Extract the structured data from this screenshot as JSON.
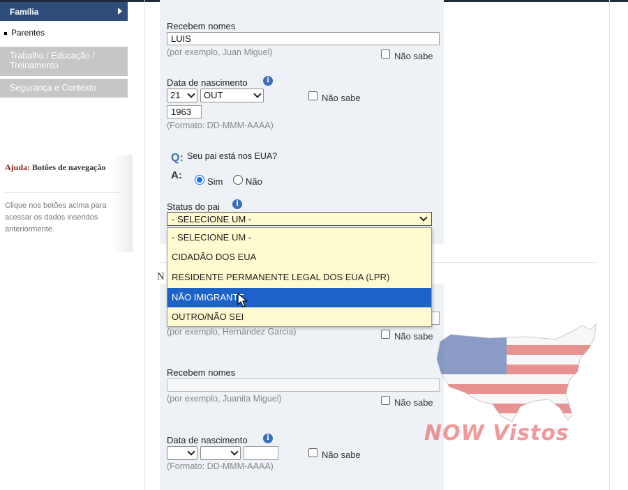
{
  "sidebar": {
    "active_item": "Família",
    "sub_item": "Parentes",
    "items": [
      {
        "label": "Trabalho / Educação / Treinamento"
      },
      {
        "label": "Segurança e Contexto"
      }
    ],
    "help": {
      "title_prefix": "Ajuda:",
      "title": "Botões de navegação",
      "text": "Clique nos botões acima para acessar os dados inseridos anteriormente."
    }
  },
  "father": {
    "given_names_label": "Recebem nomes",
    "given_names_value": "LUIS",
    "given_names_hint": "(por exemplo, Juan Miguel)",
    "dob_label": "Data de nascimento",
    "dob_day": "21",
    "dob_month": "OUT",
    "dob_year": "1963",
    "dob_hint": "(Formato: DD-MMM-AAAA)",
    "dont_know": "Não sabe",
    "question_q": "Q:",
    "question_text": "Seu pai está nos EUA?",
    "question_a": "A:",
    "yes": "Sim",
    "no": "Não",
    "status_label": "Status do pai",
    "status_selected": "- SELECIONE UM -",
    "status_options": [
      "- SELECIONE UM -",
      "CIDADÃO DOS EUA",
      "RESIDENTE PERMANENTE LEGAL DOS EUA (LPR)",
      "NÃO IMIGRANTE",
      "OUTRO/NÃO SEI"
    ],
    "highlighted_index": 3
  },
  "mother": {
    "section_letter": "N",
    "surname_hint": "(por exemplo, Hernández Garcia)",
    "given_names_label": "Recebem nomes",
    "given_names_value": "",
    "given_names_hint": "(por exemplo, Juanita Miguel)",
    "dob_label": "Data de nascimento",
    "dob_hint": "(Formato: DD-MMM-AAAA)",
    "dont_know": "Não sabe"
  },
  "watermark": {
    "text": "NOW Vistos"
  },
  "colors": {
    "nav_active": "#2e4d7b",
    "nav_gray": "#c6c6c6",
    "dropdown_bg": "#fffbd0",
    "dropdown_highlight": "#1d62c9",
    "info_icon": "#3b6fb5"
  }
}
